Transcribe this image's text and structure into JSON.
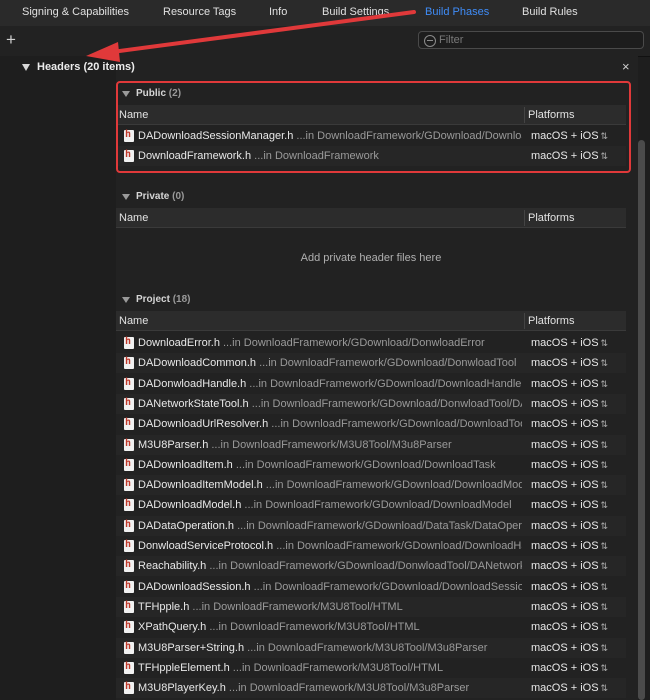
{
  "tabs": [
    "Signing & Capabilities",
    "Resource Tags",
    "Info",
    "Build Settings",
    "Build Phases",
    "Build Rules"
  ],
  "active_tab": "Build Phases",
  "toolbar": {
    "add": "+",
    "filter_placeholder": "Filter"
  },
  "phase": {
    "title": "Headers (20 items)",
    "close": "×"
  },
  "columns": {
    "name": "Name",
    "platforms": "Platforms"
  },
  "groups": {
    "public": {
      "title": "Public",
      "count": "(2)",
      "files": [
        {
          "name": "DADownloadSessionManager.h",
          "path": "...in DownloadFramework/GDownload/Downloa...",
          "platform": "macOS + iOS"
        },
        {
          "name": "DownloadFramework.h",
          "path": "...in DownloadFramework",
          "platform": "macOS + iOS"
        }
      ]
    },
    "private": {
      "title": "Private",
      "count": "(0)",
      "empty": "Add private header files here"
    },
    "project": {
      "title": "Project",
      "count": "(18)",
      "files": [
        {
          "name": "DownloadError.h",
          "path": "...in DownloadFramework/GDownload/DonwloadError",
          "platform": "macOS + iOS"
        },
        {
          "name": "DADownloadCommon.h",
          "path": "...in DownloadFramework/GDownload/DonwloadTool",
          "platform": "macOS + iOS"
        },
        {
          "name": "DADonwloadHandle.h",
          "path": "...in DownloadFramework/GDownload/DownloadHandle",
          "platform": "macOS + iOS"
        },
        {
          "name": "DANetworkStateTool.h",
          "path": "...in DownloadFramework/GDownload/DonwloadTool/DA...",
          "platform": "macOS + iOS"
        },
        {
          "name": "DADownloadUrlResolver.h",
          "path": "...in DownloadFramework/GDownload/DownloadTool...",
          "platform": "macOS + iOS"
        },
        {
          "name": "M3U8Parser.h",
          "path": "...in DownloadFramework/M3U8Tool/M3u8Parser",
          "platform": "macOS + iOS"
        },
        {
          "name": "DADownloadItem.h",
          "path": "...in DownloadFramework/GDownload/DownloadTask",
          "platform": "macOS + iOS"
        },
        {
          "name": "DADownloadItemModel.h",
          "path": "...in DownloadFramework/GDownload/DownloadModel",
          "platform": "macOS + iOS"
        },
        {
          "name": "DADownloadModel.h",
          "path": "...in DownloadFramework/GDownload/DownloadModel",
          "platform": "macOS + iOS"
        },
        {
          "name": "DADataOperation.h",
          "path": "...in DownloadFramework/GDownload/DataTask/DataOperat...",
          "platform": "macOS + iOS"
        },
        {
          "name": "DonwloadServiceProtocol.h",
          "path": "...in DownloadFramework/GDownload/DownloadHa...",
          "platform": "macOS + iOS"
        },
        {
          "name": "Reachability.h",
          "path": "...in DownloadFramework/GDownload/DonwloadTool/DANetwork...",
          "platform": "macOS + iOS"
        },
        {
          "name": "DADownloadSession.h",
          "path": "...in DownloadFramework/GDownload/DownloadSession",
          "platform": "macOS + iOS"
        },
        {
          "name": "TFHpple.h",
          "path": "...in DownloadFramework/M3U8Tool/HTML",
          "platform": "macOS + iOS"
        },
        {
          "name": "XPathQuery.h",
          "path": "...in DownloadFramework/M3U8Tool/HTML",
          "platform": "macOS + iOS"
        },
        {
          "name": "M3U8Parser+String.h",
          "path": "...in DownloadFramework/M3U8Tool/M3u8Parser",
          "platform": "macOS + iOS"
        },
        {
          "name": "TFHppleElement.h",
          "path": "...in DownloadFramework/M3U8Tool/HTML",
          "platform": "macOS + iOS"
        },
        {
          "name": "M3U8PlayerKey.h",
          "path": "...in DownloadFramework/M3U8Tool/M3u8Parser",
          "platform": "macOS + iOS"
        }
      ]
    }
  },
  "colors": {
    "accent": "#3f8cf7",
    "annotation_red": "#e0393a",
    "background": "#1e1e1e"
  }
}
